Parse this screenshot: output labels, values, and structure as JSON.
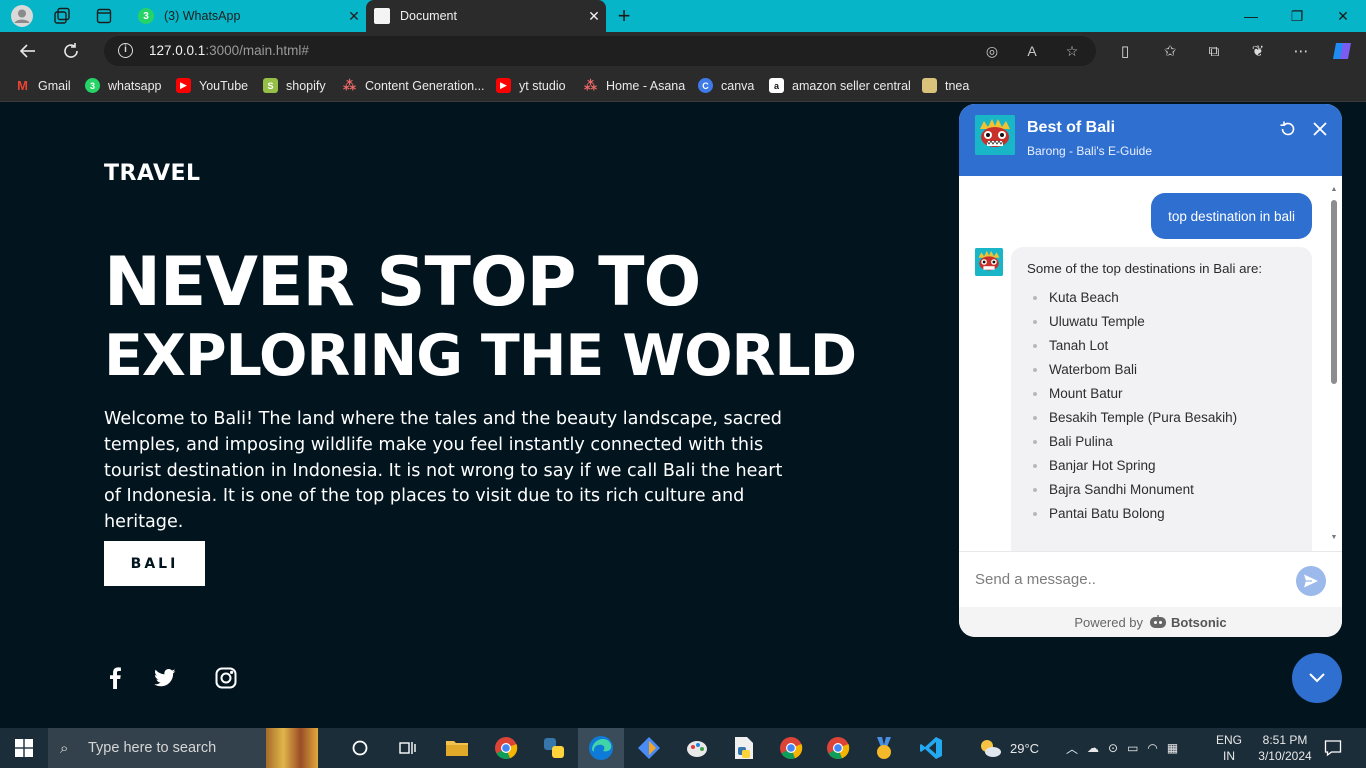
{
  "browser": {
    "tabs": [
      {
        "label": "(3) WhatsApp",
        "badge": "3",
        "active": false
      },
      {
        "label": "Document",
        "active": true
      }
    ],
    "address": {
      "host": "127.0.0.1",
      "path": ":3000/main.html#"
    },
    "bookmarks": [
      {
        "label": "Gmail",
        "icon": "gmail-icon",
        "color": "#ea4335"
      },
      {
        "label": "whatsapp",
        "icon": "whatsapp-icon",
        "color": "#25d366"
      },
      {
        "label": "YouTube",
        "icon": "youtube-icon",
        "color": "#ff0000"
      },
      {
        "label": "shopify",
        "icon": "shopify-icon",
        "color": "#95bf47"
      },
      {
        "label": "Content Generation...",
        "icon": "asana-icon",
        "color": "#f06a6a"
      },
      {
        "label": "yt studio",
        "icon": "youtube-studio-icon",
        "color": "#ff0000"
      },
      {
        "label": "Home - Asana",
        "icon": "asana-icon",
        "color": "#f06a6a"
      },
      {
        "label": "canva",
        "icon": "canva-icon",
        "color": "#00c4cc"
      },
      {
        "label": "amazon seller central",
        "icon": "amazon-icon",
        "color": "#ffffff"
      },
      {
        "label": "tnea",
        "icon": "tnea-icon",
        "color": "#d9c27a"
      }
    ]
  },
  "site": {
    "brand": "TRAVEL",
    "headline_line1": "NEVER STOP TO",
    "headline_line2": "EXPLORING THE WORLD",
    "intro": "Welcome to Bali! The land where the tales and the beauty landscape, sacred temples, and imposing wildlife make you feel instantly connected with this tourist destination in Indonesia. It is not wrong to say if we call Bali the heart of Indonesia. It is one of the top places to visit due to its rich culture and heritage.",
    "cta_label": "BALI",
    "social": [
      "facebook-icon",
      "twitter-icon",
      "instagram-icon"
    ]
  },
  "chatbot": {
    "title": "Best of Bali",
    "subtitle": "Barong - Bali's E-Guide",
    "user_message": "top destination in bali",
    "bot_lead": "Some of the top destinations in Bali are:",
    "destinations": [
      "Kuta Beach",
      "Uluwatu Temple",
      "Tanah Lot",
      "Waterbom Bali",
      "Mount Batur",
      "Besakih Temple (Pura Besakih)",
      "Bali Pulina",
      "Banjar Hot Spring",
      "Bajra Sandhi Monument",
      "Pantai Batu Bolong"
    ],
    "input_placeholder": "Send a message..",
    "powered_by": "Powered by",
    "powered_brand": "Botsonic",
    "accent": "#2f6fd0"
  },
  "taskbar": {
    "search_placeholder": "Type here to search",
    "weather": "29°C",
    "language": "ENG",
    "region": "IN",
    "time": "8:51 PM",
    "date": "3/10/2024"
  }
}
